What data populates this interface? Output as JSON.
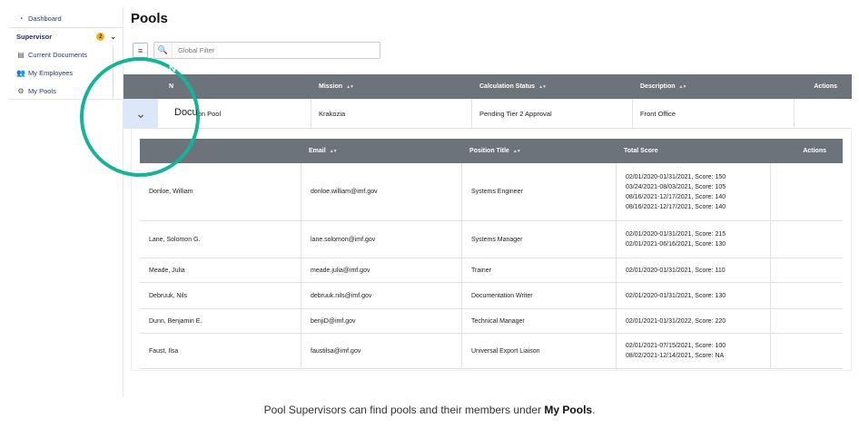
{
  "sidebar": {
    "dashboard": "Dashboard",
    "supervisor": "Supervisor",
    "supervisor_badge": "2",
    "current_documents": "Current Documents",
    "my_employees": "My Employees",
    "my_pools": "My Pools"
  },
  "page": {
    "title": "Pools",
    "filter_placeholder": "Global Filter"
  },
  "pools_table": {
    "headers": {
      "name": "N",
      "mission": "Mission",
      "calculation_status": "Calculation Status",
      "description": "Description",
      "actions": "Actions"
    },
    "row": {
      "name_prefix": "Docu",
      "name_suffix": "on Pool",
      "mission": "Krakozia",
      "calculation_status": "Pending Tier 2 Approval",
      "description": "Front Office"
    }
  },
  "members_table": {
    "headers": {
      "email": "Email",
      "position_title": "Position Title",
      "total_score": "Total Score",
      "actions": "Actions"
    },
    "rows": [
      {
        "name": "Donloe, William",
        "email": "donloe.william@imf.gov",
        "position": "Systems Engineer",
        "scores": [
          "02/01/2020-01/31/2021, Score: 150",
          "03/24/2021-08/03/2021, Score: 105",
          "08/16/2021-12/17/2021, Score: 140",
          "08/16/2021-12/17/2021, Score: 140"
        ]
      },
      {
        "name": "Lane, Solomon G.",
        "email": "lane.solomon@imf.gov",
        "position": "Systems Manager",
        "scores": [
          "02/01/2020-01/31/2021, Score: 215",
          "02/01/2021-06/16/2021, Score: 130"
        ]
      },
      {
        "name": "Meade, Julia",
        "email": "meade.julia@imf.gov",
        "position": "Trainer",
        "scores": [
          "02/01/2020-01/31/2021, Score: 110"
        ]
      },
      {
        "name": "Debruuk, Nils",
        "email": "debruuk.nils@imf.gov",
        "position": "Documentation Writer",
        "scores": [
          "02/01/2020-01/31/2021, Score: 130"
        ]
      },
      {
        "name": "Dunn, Benjamin E.",
        "email": "benjiD@imf.gov",
        "position": "Technical Manager",
        "scores": [
          "02/01/2021-01/31/2022, Score: 220"
        ]
      },
      {
        "name": "Faust, Ilsa",
        "email": "faustilsa@imf.gov",
        "position": "Universal Export Liaison",
        "scores": [
          "02/01/2021-07/15/2021, Score: 100",
          "08/02/2021-12/14/2021, Score: NA"
        ]
      }
    ]
  },
  "caption": {
    "text": "Pool Supervisors can find pools and their members under ",
    "bold": "My Pools",
    "end": "."
  },
  "colors": {
    "header_bg": "#6c737a",
    "accent_ring": "#17b398",
    "badge": "#f0b323",
    "expander_bg": "#dce8f8"
  }
}
